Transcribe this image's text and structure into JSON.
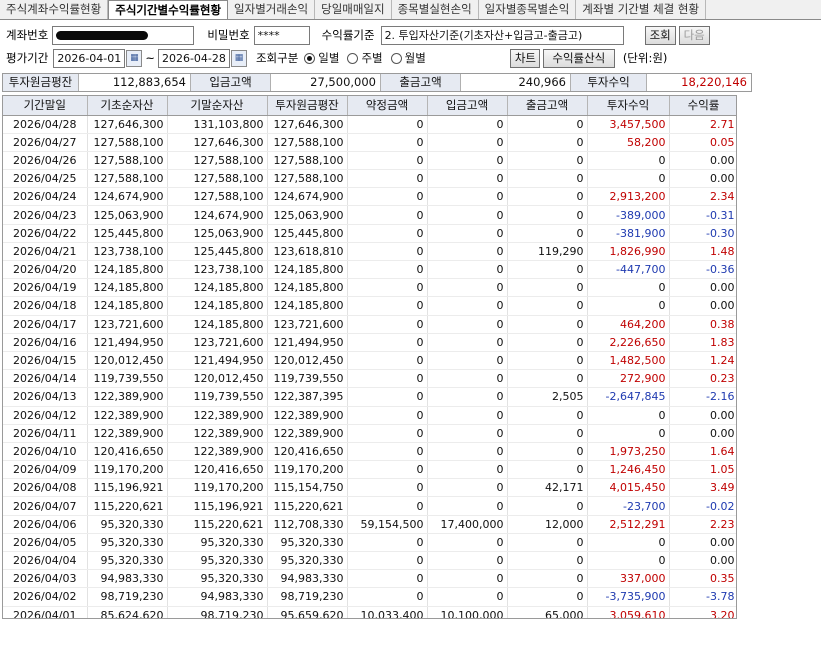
{
  "tabs": [
    {
      "label": "주식계좌수익률현황",
      "active": false
    },
    {
      "label": "주식기간별수익률현황",
      "active": true
    },
    {
      "label": "일자별거래손익",
      "active": false
    },
    {
      "label": "당일매매일지",
      "active": false
    },
    {
      "label": "종목별실현손익",
      "active": false
    },
    {
      "label": "일자별종목별손익",
      "active": false
    },
    {
      "label": "계좌별 기간별 체결 현황",
      "active": false
    }
  ],
  "controls": {
    "account_label": "계좌번호",
    "password_label": "비밀번호",
    "password_value": "****",
    "basis_label": "수익률기준",
    "basis_value": "2. 투입자산기준(기초자산+입금고-출금고)",
    "query_button": "조회",
    "next_button": "다음",
    "period_label": "평가기간",
    "date_from": "2026-04-01",
    "date_sep": "~",
    "date_to": "2026-04-28",
    "calendar_icon": "calendar-icon",
    "query_type_label": "조회구분",
    "radio_daily": "일별",
    "radio_weekly": "주별",
    "radio_monthly": "월별",
    "selected_radio": "일별",
    "chart_button": "차트",
    "formula_button": "수익률산식",
    "unit_label": "(단위:원)"
  },
  "summary": {
    "avg_principal_label": "투자원금평잔",
    "avg_principal_value": "112,883,654",
    "deposit_label": "입금고액",
    "deposit_value": "27,500,000",
    "withdraw_label": "출금고액",
    "withdraw_value": "240,966",
    "profit_label": "투자수익",
    "profit_value": "18,220,146",
    "profit_color": "#c00000"
  },
  "table": {
    "headers": [
      "기간말일",
      "기초순자산",
      "기말순자산",
      "투자원금평잔",
      "약정금액",
      "입금고액",
      "출금고액",
      "투자수익",
      "수익률"
    ],
    "rows": [
      [
        "2026/04/28",
        "127,646,300",
        "131,103,800",
        "127,646,300",
        "0",
        "0",
        "0",
        "3,457,500",
        "2.71"
      ],
      [
        "2026/04/27",
        "127,588,100",
        "127,646,300",
        "127,588,100",
        "0",
        "0",
        "0",
        "58,200",
        "0.05"
      ],
      [
        "2026/04/26",
        "127,588,100",
        "127,588,100",
        "127,588,100",
        "0",
        "0",
        "0",
        "0",
        "0.00"
      ],
      [
        "2026/04/25",
        "127,588,100",
        "127,588,100",
        "127,588,100",
        "0",
        "0",
        "0",
        "0",
        "0.00"
      ],
      [
        "2026/04/24",
        "124,674,900",
        "127,588,100",
        "124,674,900",
        "0",
        "0",
        "0",
        "2,913,200",
        "2.34"
      ],
      [
        "2026/04/23",
        "125,063,900",
        "124,674,900",
        "125,063,900",
        "0",
        "0",
        "0",
        "-389,000",
        "-0.31"
      ],
      [
        "2026/04/22",
        "125,445,800",
        "125,063,900",
        "125,445,800",
        "0",
        "0",
        "0",
        "-381,900",
        "-0.30"
      ],
      [
        "2026/04/21",
        "123,738,100",
        "125,445,800",
        "123,618,810",
        "0",
        "0",
        "119,290",
        "1,826,990",
        "1.48"
      ],
      [
        "2026/04/20",
        "124,185,800",
        "123,738,100",
        "124,185,800",
        "0",
        "0",
        "0",
        "-447,700",
        "-0.36"
      ],
      [
        "2026/04/19",
        "124,185,800",
        "124,185,800",
        "124,185,800",
        "0",
        "0",
        "0",
        "0",
        "0.00"
      ],
      [
        "2026/04/18",
        "124,185,800",
        "124,185,800",
        "124,185,800",
        "0",
        "0",
        "0",
        "0",
        "0.00"
      ],
      [
        "2026/04/17",
        "123,721,600",
        "124,185,800",
        "123,721,600",
        "0",
        "0",
        "0",
        "464,200",
        "0.38"
      ],
      [
        "2026/04/16",
        "121,494,950",
        "123,721,600",
        "121,494,950",
        "0",
        "0",
        "0",
        "2,226,650",
        "1.83"
      ],
      [
        "2026/04/15",
        "120,012,450",
        "121,494,950",
        "120,012,450",
        "0",
        "0",
        "0",
        "1,482,500",
        "1.24"
      ],
      [
        "2026/04/14",
        "119,739,550",
        "120,012,450",
        "119,739,550",
        "0",
        "0",
        "0",
        "272,900",
        "0.23"
      ],
      [
        "2026/04/13",
        "122,389,900",
        "119,739,550",
        "122,387,395",
        "0",
        "0",
        "2,505",
        "-2,647,845",
        "-2.16"
      ],
      [
        "2026/04/12",
        "122,389,900",
        "122,389,900",
        "122,389,900",
        "0",
        "0",
        "0",
        "0",
        "0.00"
      ],
      [
        "2026/04/11",
        "122,389,900",
        "122,389,900",
        "122,389,900",
        "0",
        "0",
        "0",
        "0",
        "0.00"
      ],
      [
        "2026/04/10",
        "120,416,650",
        "122,389,900",
        "120,416,650",
        "0",
        "0",
        "0",
        "1,973,250",
        "1.64"
      ],
      [
        "2026/04/09",
        "119,170,200",
        "120,416,650",
        "119,170,200",
        "0",
        "0",
        "0",
        "1,246,450",
        "1.05"
      ],
      [
        "2026/04/08",
        "115,196,921",
        "119,170,200",
        "115,154,750",
        "0",
        "0",
        "42,171",
        "4,015,450",
        "3.49"
      ],
      [
        "2026/04/07",
        "115,220,621",
        "115,196,921",
        "115,220,621",
        "0",
        "0",
        "0",
        "-23,700",
        "-0.02"
      ],
      [
        "2026/04/06",
        "95,320,330",
        "115,220,621",
        "112,708,330",
        "59,154,500",
        "17,400,000",
        "12,000",
        "2,512,291",
        "2.23"
      ],
      [
        "2026/04/05",
        "95,320,330",
        "95,320,330",
        "95,320,330",
        "0",
        "0",
        "0",
        "0",
        "0.00"
      ],
      [
        "2026/04/04",
        "95,320,330",
        "95,320,330",
        "95,320,330",
        "0",
        "0",
        "0",
        "0",
        "0.00"
      ],
      [
        "2026/04/03",
        "94,983,330",
        "95,320,330",
        "94,983,330",
        "0",
        "0",
        "0",
        "337,000",
        "0.35"
      ],
      [
        "2026/04/02",
        "98,719,230",
        "94,983,330",
        "98,719,230",
        "0",
        "0",
        "0",
        "-3,735,900",
        "-3.78"
      ],
      [
        "2026/04/01",
        "85,624,620",
        "98,719,230",
        "95,659,620",
        "10,033,400",
        "10,100,000",
        "65,000",
        "3,059,610",
        "3.20"
      ]
    ]
  },
  "colors": {
    "positive": "#c00000",
    "negative": "#1f3ab0",
    "header_bg": "#e6eaf2"
  }
}
